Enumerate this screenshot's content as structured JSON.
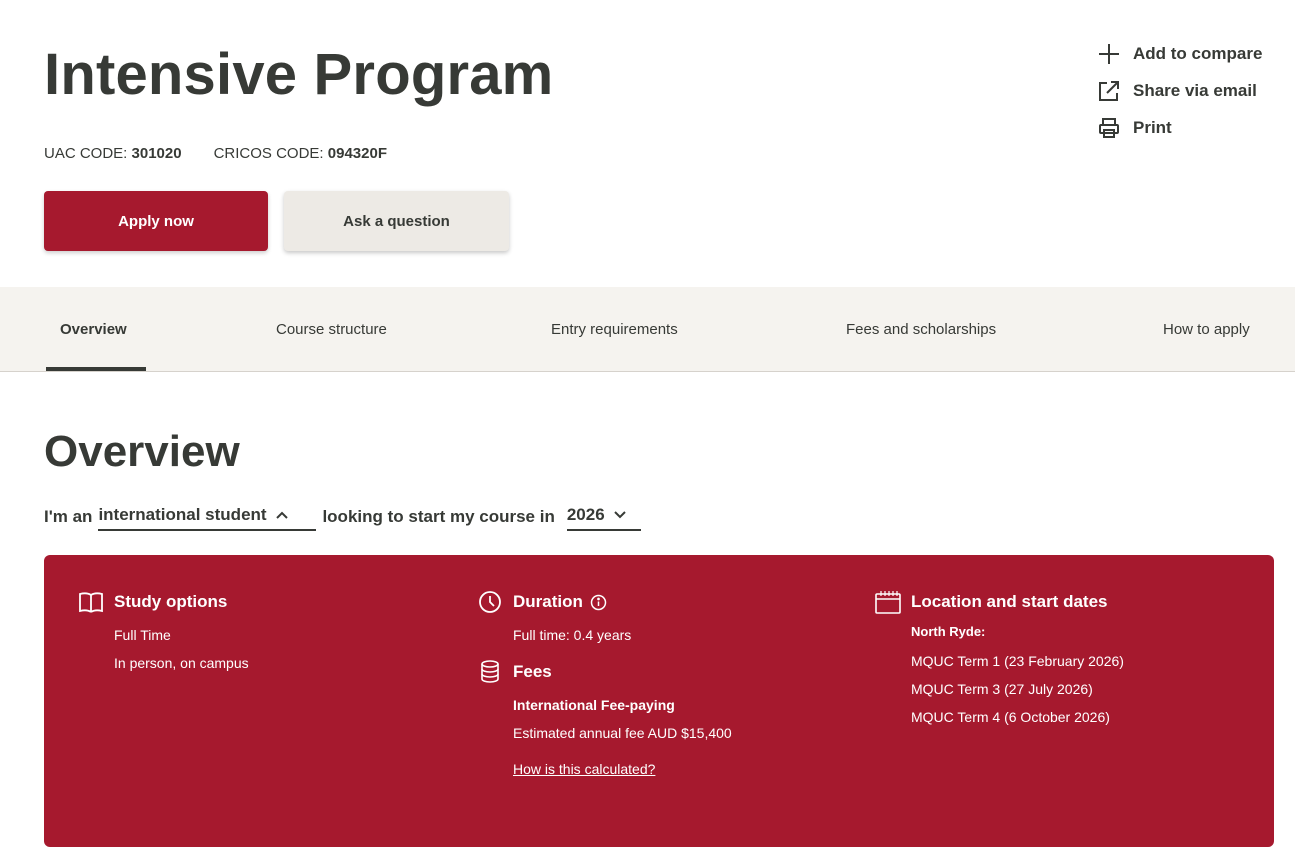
{
  "header": {
    "title": "Intensive Program",
    "uac_label": "UAC CODE:",
    "uac_value": "301020",
    "cricos_label": "CRICOS CODE:",
    "cricos_value": "094320F",
    "apply_label": "Apply now",
    "ask_label": "Ask a question"
  },
  "actions": {
    "compare": "Add to compare",
    "share": "Share via email",
    "print": "Print"
  },
  "tabs": [
    {
      "label": "Overview",
      "active": true
    },
    {
      "label": "Course structure",
      "active": false
    },
    {
      "label": "Entry requirements",
      "active": false
    },
    {
      "label": "Fees and scholarships",
      "active": false
    },
    {
      "label": "How to apply",
      "active": false
    }
  ],
  "overview": {
    "heading": "Overview",
    "prefix": "I'm an",
    "student_type": "international student",
    "middle": "looking to start my course in",
    "year": "2026"
  },
  "panel": {
    "study": {
      "heading": "Study options",
      "lines": [
        "Full Time",
        "In person, on campus"
      ]
    },
    "duration": {
      "heading": "Duration",
      "text": "Full time: 0.4 years"
    },
    "fees": {
      "heading": "Fees",
      "type": "International Fee-paying",
      "estimate": "Estimated annual fee AUD $15,400",
      "link": "How is this calculated?"
    },
    "location": {
      "heading": "Location and start dates",
      "campus": "North Ryde:",
      "dates": [
        "MQUC Term 1 (23 February 2026)",
        "MQUC Term 3 (27 July 2026)",
        "MQUC Term 4 (6 October 2026)"
      ]
    }
  },
  "colors": {
    "brand_red": "#a6192e",
    "text_dark": "#373a36",
    "tab_bg": "#f5f3ef",
    "secondary_btn": "#edeae5"
  }
}
